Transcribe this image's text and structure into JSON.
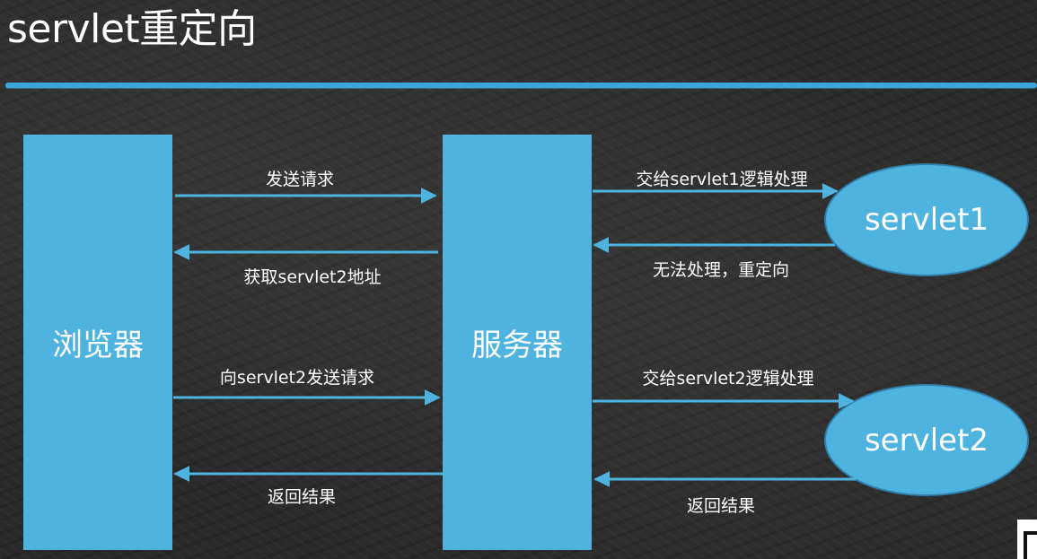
{
  "title": "servlet重定向",
  "nodes": {
    "browser": "浏览器",
    "server": "服务器",
    "servlet1": "servlet1",
    "servlet2": "servlet2"
  },
  "arrows": {
    "send_request": "发送请求",
    "get_address": "获取servlet2地址",
    "send_to_servlet2": "向servlet2发送请求",
    "return_result_left": "返回结果",
    "to_servlet1": "交给servlet1逻辑处理",
    "cannot_handle": "无法处理，重定向",
    "to_servlet2": "交给servlet2逻辑处理",
    "return_result_right": "返回结果"
  },
  "colors": {
    "accent": "#4fb3e0",
    "background": "#2a2a2a",
    "text": "#ffffff"
  }
}
